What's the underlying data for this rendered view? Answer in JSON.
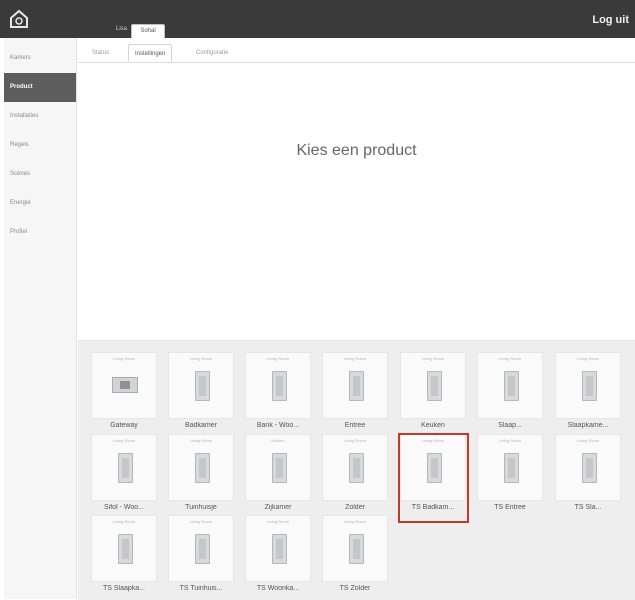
{
  "header": {
    "logout_label": "Log uit",
    "tabs": [
      {
        "label": "Lisa"
      },
      {
        "label": "Sohal"
      }
    ]
  },
  "sidebar": {
    "items": [
      {
        "label": "Kamers"
      },
      {
        "label": "Product"
      },
      {
        "label": "Installaties"
      },
      {
        "label": "Regels"
      },
      {
        "label": "Scènes"
      },
      {
        "label": "Energie"
      },
      {
        "label": "Profiel"
      }
    ],
    "active_index": 1
  },
  "subtabs": [
    {
      "label": "Status"
    },
    {
      "label": "Instellingen"
    },
    {
      "label": "Configuratie"
    }
  ],
  "main": {
    "headline": "Kies een product"
  },
  "products": [
    {
      "name": "Gateway",
      "tag": "Living Room",
      "icon": "gateway-icon"
    },
    {
      "name": "Badkamer",
      "tag": "Living Room",
      "icon": "device-icon"
    },
    {
      "name": "Bank - Woo...",
      "tag": "Living Room",
      "icon": "device-icon"
    },
    {
      "name": "Entree",
      "tag": "Living Room",
      "icon": "device-icon"
    },
    {
      "name": "Keuken",
      "tag": "Living Room",
      "icon": "device-icon"
    },
    {
      "name": "Slaap...",
      "tag": "Living Room",
      "icon": "device-icon"
    },
    {
      "name": "Slaapkame...",
      "tag": "Living Room",
      "icon": "device-icon"
    },
    {
      "name": "Sifol - Woo...",
      "tag": "Living Room",
      "icon": "device-icon"
    },
    {
      "name": "Tuinhuisje",
      "tag": "Living Room",
      "icon": "device-icon"
    },
    {
      "name": "Zijkamer",
      "tag": "Kitchen",
      "icon": "device-icon"
    },
    {
      "name": "Zolder",
      "tag": "Living Room",
      "icon": "device-icon"
    },
    {
      "name": "TS Badkam...",
      "tag": "Living Room",
      "icon": "device-icon"
    },
    {
      "name": "TS Entree",
      "tag": "Living Room",
      "icon": "device-icon"
    },
    {
      "name": "TS      Sla...",
      "tag": "Living Room",
      "icon": "device-icon"
    },
    {
      "name": "TS Slaapka...",
      "tag": "Living Room",
      "icon": "device-icon"
    },
    {
      "name": "TS Tuinhuis...",
      "tag": "Living Room",
      "icon": "device-icon"
    },
    {
      "name": "TS Woonka...",
      "tag": "Living Room",
      "icon": "device-icon"
    },
    {
      "name": "TS Zolder",
      "tag": "Living Room",
      "icon": "device-icon"
    }
  ],
  "selected_product_index": 11
}
